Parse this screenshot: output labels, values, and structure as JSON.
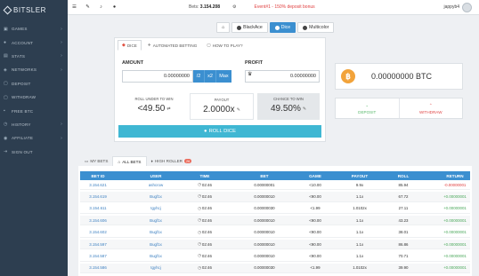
{
  "brand": "BITSLER",
  "sidebar": {
    "items": [
      {
        "label": "GAMES",
        "icon": "gamepad-icon",
        "glyph": "▣",
        "chevron": true
      },
      {
        "label": "ACCOUNT",
        "icon": "user-icon",
        "glyph": "●",
        "chevron": true
      },
      {
        "label": "STATS",
        "icon": "stats-icon",
        "glyph": "▤",
        "chevron": true
      },
      {
        "label": "NETWORKS",
        "icon": "network-icon",
        "glyph": "◈",
        "chevron": true
      },
      {
        "label": "DEPOSIT",
        "icon": "deposit-icon",
        "glyph": "▢",
        "chevron": false
      },
      {
        "label": "WITHDRAW",
        "icon": "withdraw-icon",
        "glyph": "▢",
        "chevron": false
      },
      {
        "label": "FREE BTC",
        "icon": "gift-icon",
        "glyph": "▪",
        "chevron": false
      },
      {
        "label": "HISTORY",
        "icon": "history-icon",
        "glyph": "◷",
        "chevron": true
      },
      {
        "label": "AFFILIATE",
        "icon": "affiliate-icon",
        "glyph": "◉",
        "chevron": true
      },
      {
        "label": "SIGN OUT",
        "icon": "signout-icon",
        "glyph": "⇥",
        "chevron": false
      }
    ]
  },
  "topbar": {
    "bets_label": "Bets:",
    "bets_value": "3.154.208",
    "promo": "Event#1 - 150% deposit bonus",
    "username": "jappyb4"
  },
  "game_tabs": [
    {
      "label": "",
      "icon": "home-icon",
      "active": false
    },
    {
      "label": "BlackAce",
      "icon": "blackace-icon",
      "active": false
    },
    {
      "label": "Dice",
      "icon": "dice-icon",
      "active": true
    },
    {
      "label": "Multicolor",
      "icon": "multicolor-icon",
      "active": false
    }
  ],
  "panel": {
    "tabs": [
      "DICE",
      "AUTOMATED BETTING",
      "HOW TO PLAY?"
    ],
    "amount_label": "AMOUNT",
    "amount_value": "0.00000000",
    "half_label": "/2",
    "double_label": "x2",
    "max_label": "Max",
    "profit_label": "PROFIT",
    "profit_value": "0.00000000",
    "roll_under_label": "ROLL UNDER TO WIN",
    "roll_under_value": "<49.50",
    "payout_label": "PAYOUT",
    "payout_value": "2.0000x",
    "chance_label": "CHANCE TO WIN",
    "chance_value": "49.50%",
    "roll_button": "ROLL DICE"
  },
  "wallet": {
    "coin_symbol": "฿",
    "balance": "0.00000000 BTC",
    "deposit_label": "DEPOSIT",
    "withdraw_label": "WITHDRAW"
  },
  "bet_tabs": [
    {
      "label": "MY BETS",
      "active": false
    },
    {
      "label": "ALL BETS",
      "active": true
    },
    {
      "label": "HIGH ROLLER",
      "active": false,
      "badge": "26"
    }
  ],
  "table": {
    "headers": [
      "BET ID",
      "USER",
      "TIME",
      "BET",
      "GAME",
      "PAYOUT",
      "ROLL",
      "RETURN"
    ],
    "rows": [
      [
        "3.154.621",
        "ashcrow",
        "02:46",
        "0.00000001",
        "<10.00",
        "9.9x",
        "85.94",
        "-0.00000001",
        "neg"
      ],
      [
        "3.154.619",
        "Bugf1x",
        "02:46",
        "0.00000010",
        "<90.00",
        "1.1x",
        "67.72",
        "+0.00000001",
        "pos"
      ],
      [
        "3.154.611",
        "tgyhcj",
        "02:46",
        "0.00000030",
        "<1.99",
        "1.0102x",
        "27.11",
        "+0.00000001",
        "pos"
      ],
      [
        "3.154.606",
        "Bugf1x",
        "02:46",
        "0.00000010",
        "<90.00",
        "1.1x",
        "43.23",
        "+0.00000001",
        "pos"
      ],
      [
        "3.154.602",
        "Bugf1x",
        "02:46",
        "0.00000010",
        "<90.00",
        "1.1x",
        "38.01",
        "+0.00000001",
        "pos"
      ],
      [
        "3.154.597",
        "Bugf1x",
        "02:46",
        "0.00000010",
        "<90.00",
        "1.1x",
        "86.86",
        "+0.00000001",
        "pos"
      ],
      [
        "3.154.587",
        "Bugf1x",
        "02:46",
        "0.00000010",
        "<90.00",
        "1.1x",
        "70.71",
        "+0.00000001",
        "pos"
      ],
      [
        "3.154.586",
        "tgyhcj",
        "02:46",
        "0.00000030",
        "<1.99",
        "1.0102x",
        "39.90",
        "+0.00000001",
        "pos"
      ]
    ]
  },
  "colors": {
    "sidebar": "#2d3e50",
    "accent": "#3b8fd0",
    "roll_button": "#3fb7d3",
    "negative": "#e03c3c",
    "positive": "#4aa85a",
    "btc": "#f2a33a"
  }
}
